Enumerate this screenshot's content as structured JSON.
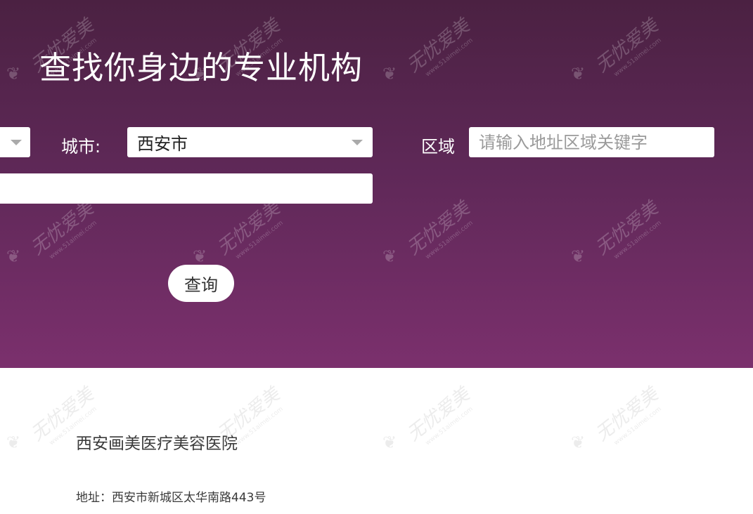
{
  "hero": {
    "title": "查找你身边的专业机构"
  },
  "form": {
    "city_label": "城市:",
    "city_value": "西安市",
    "district_label": "区域",
    "district_placeholder": "请输入地址区域关键字",
    "submit_label": "查询"
  },
  "results": [
    {
      "name": "西安画美医疗美容医院",
      "address": "地址：西安市新城区太华南路443号"
    }
  ],
  "watermark": {
    "text": "无忧爱美",
    "url": "www.51aimei.com"
  },
  "colors": {
    "hero_top": "#4b2142",
    "hero_bottom": "#7b306d",
    "text_dark": "#3a3a3a"
  }
}
